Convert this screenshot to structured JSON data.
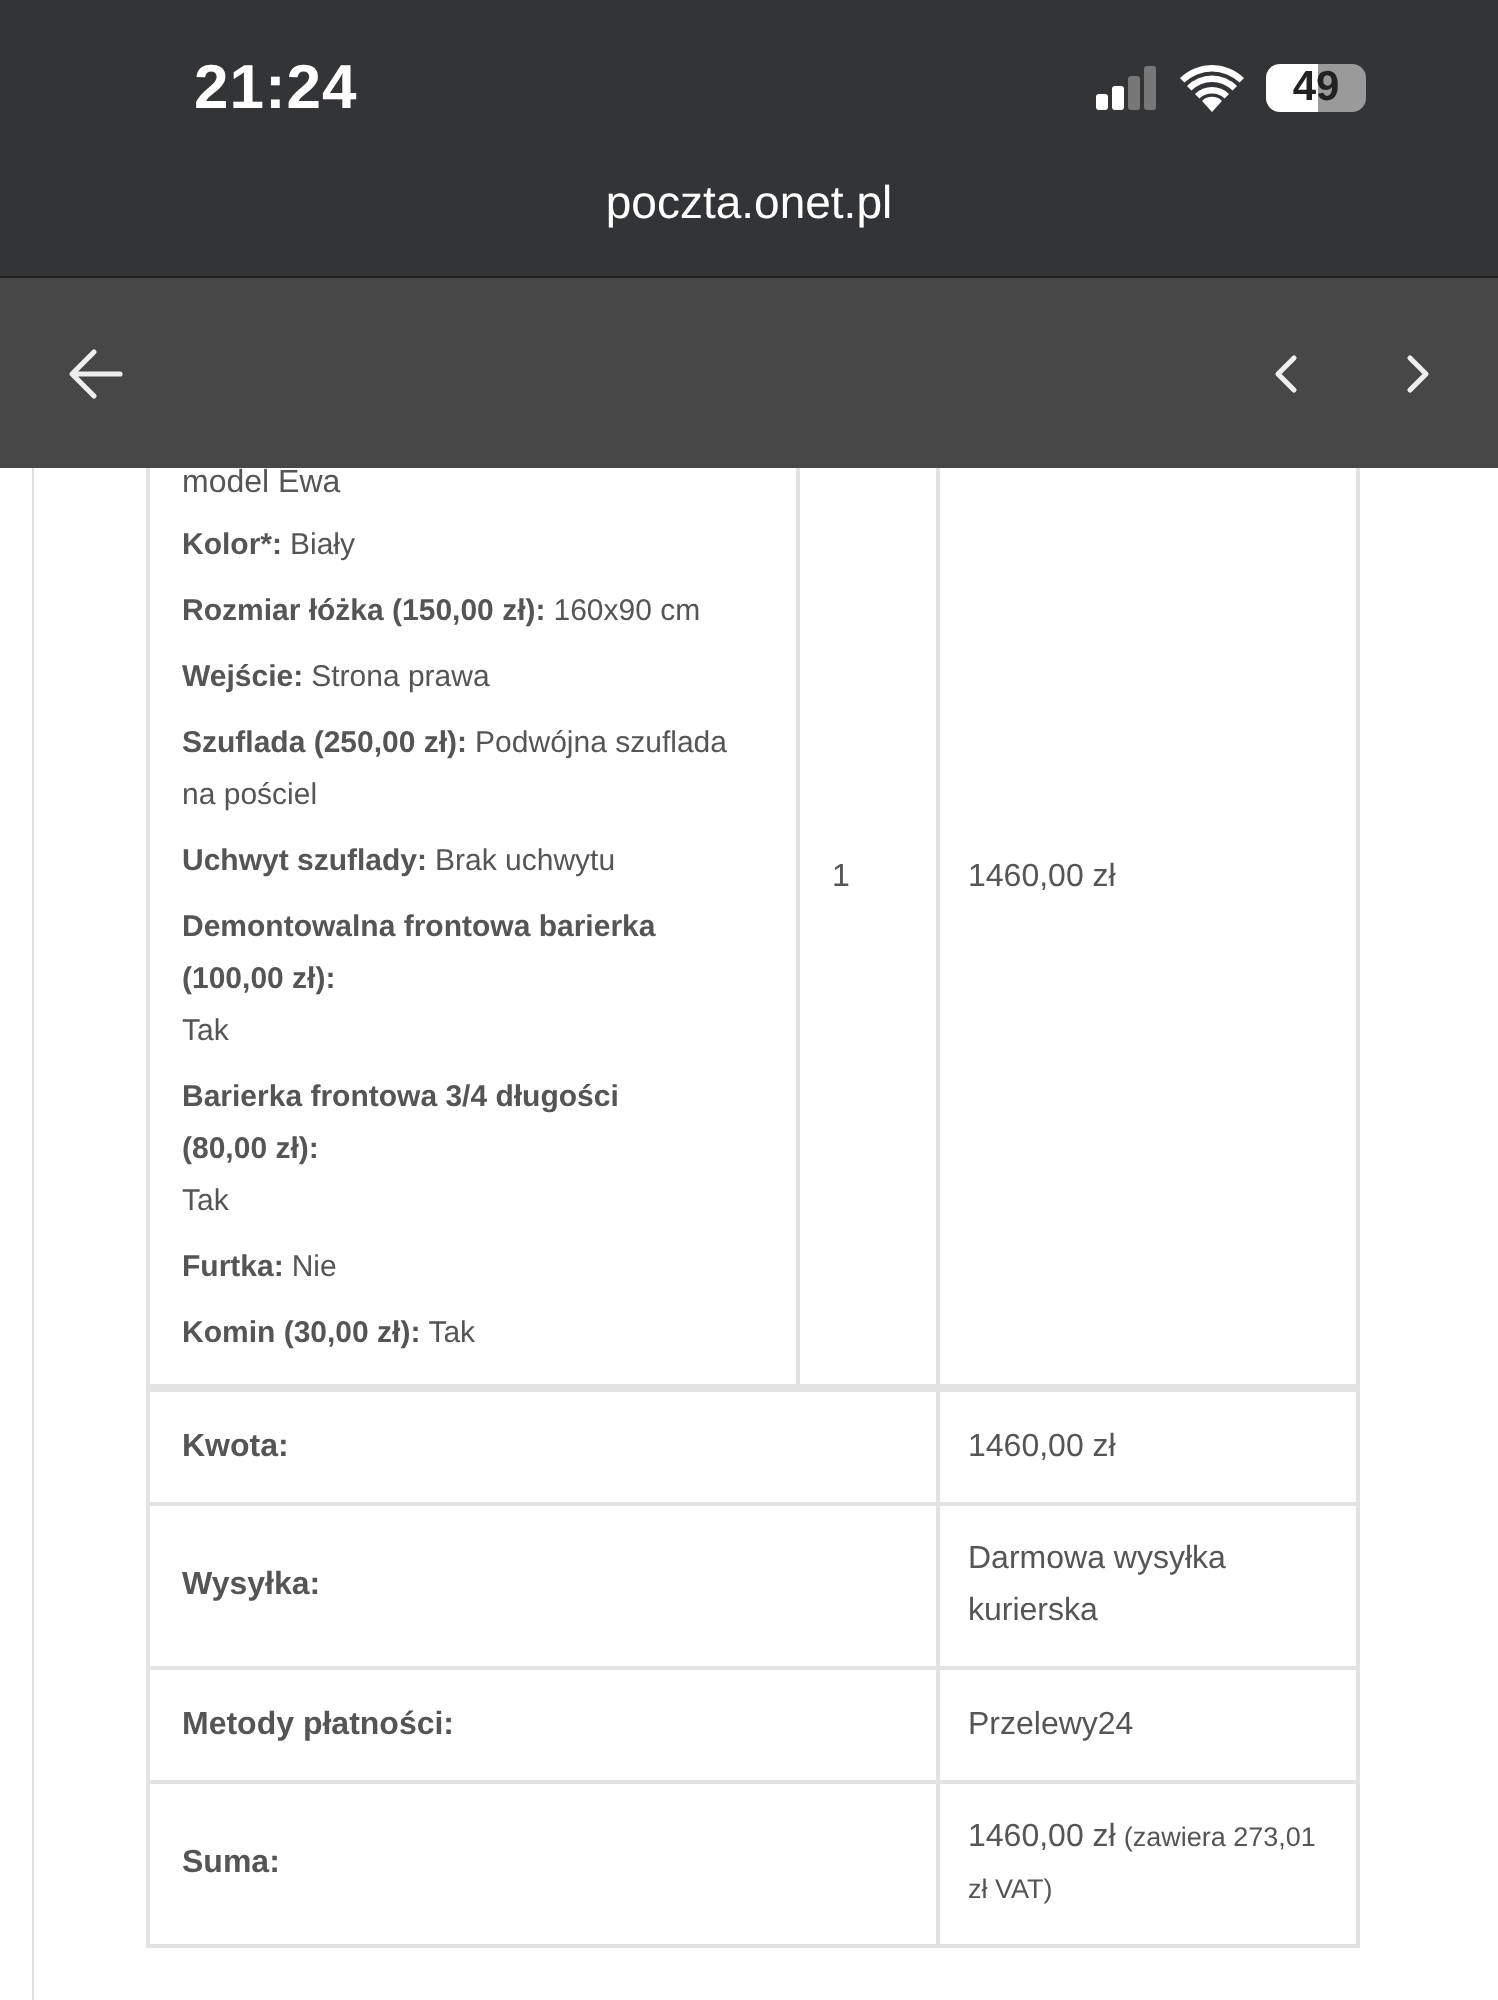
{
  "status_bar": {
    "time": "21:24",
    "battery": "49"
  },
  "address_bar": {
    "url": "poczta.onet.pl"
  },
  "order_item": {
    "product_lines": [
      "model Ewa"
    ],
    "options": [
      {
        "kind": "inline",
        "label": "Kolor*:",
        "value": "Biały"
      },
      {
        "kind": "inline",
        "label": "Rozmiar łóżka (150,00 zł):",
        "value": "160x90 cm"
      },
      {
        "kind": "inline",
        "label": "Wejście:",
        "value": "Strona prawa"
      },
      {
        "kind": "inline",
        "label": "Szuflada (250,00 zł):",
        "value": "Podwójna szuflada na pościel"
      },
      {
        "kind": "inline",
        "label": "Uchwyt szuflady:",
        "value": "Brak uchwytu"
      },
      {
        "kind": "stacked",
        "label": "Demontowalna frontowa barierka (100,00 zł):",
        "value": "Tak"
      },
      {
        "kind": "stacked",
        "label": "Barierka frontowa 3/4 długości (80,00 zł):",
        "value": "Tak"
      },
      {
        "kind": "inline",
        "label": "Furtka:",
        "value": "Nie"
      },
      {
        "kind": "inline",
        "label": "Komin (30,00 zł):",
        "value": "Tak"
      }
    ],
    "quantity": "1",
    "price": "1460,00 zł"
  },
  "totals": [
    {
      "label": "Kwota:",
      "value": "1460,00 zł"
    },
    {
      "label": "Wysyłka:",
      "value": "Darmowa wysyłka kurierska"
    },
    {
      "label": "Metody płatności:",
      "value": "Przelewy24"
    },
    {
      "label": "Suma:",
      "value": "1460,00 zł",
      "note": "(zawiera 273,01 zł VAT)"
    }
  ]
}
